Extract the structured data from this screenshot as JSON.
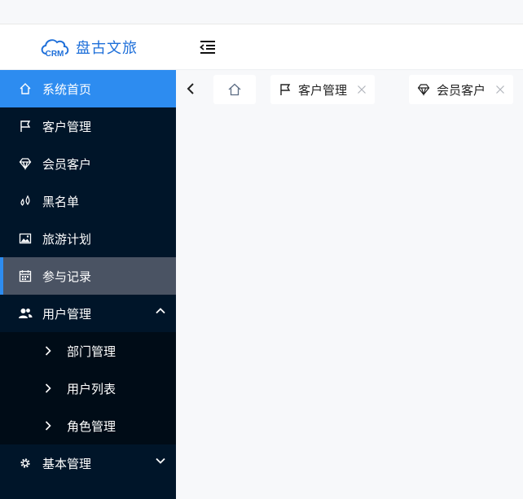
{
  "app": {
    "name": "盘古文旅",
    "logo_text": "CRM"
  },
  "sidebar": {
    "items": [
      {
        "label": "系统首页",
        "icon": "home-icon"
      },
      {
        "label": "客户管理",
        "icon": "flag-icon"
      },
      {
        "label": "会员客户",
        "icon": "diamond-icon"
      },
      {
        "label": "黑名单",
        "icon": "drops-icon"
      },
      {
        "label": "旅游计划",
        "icon": "image-icon"
      },
      {
        "label": "参与记录",
        "icon": "calendar-icon"
      },
      {
        "label": "用户管理",
        "icon": "users-icon",
        "expanded": true,
        "children": [
          {
            "label": "部门管理"
          },
          {
            "label": "用户列表"
          },
          {
            "label": "角色管理"
          }
        ]
      },
      {
        "label": "基本管理",
        "icon": "gear-icon",
        "expanded": false
      }
    ]
  },
  "tabs": [
    {
      "label": "",
      "icon": "home-icon"
    },
    {
      "label": "客户管理",
      "icon": "flag-icon"
    },
    {
      "label": "会员客户",
      "icon": "diamond-icon"
    }
  ],
  "colors": {
    "sidebar_bg": "#001529",
    "accent": "#2d8cf0",
    "selected_bg": "#4a5363",
    "brand_text": "#1e6fd9"
  }
}
